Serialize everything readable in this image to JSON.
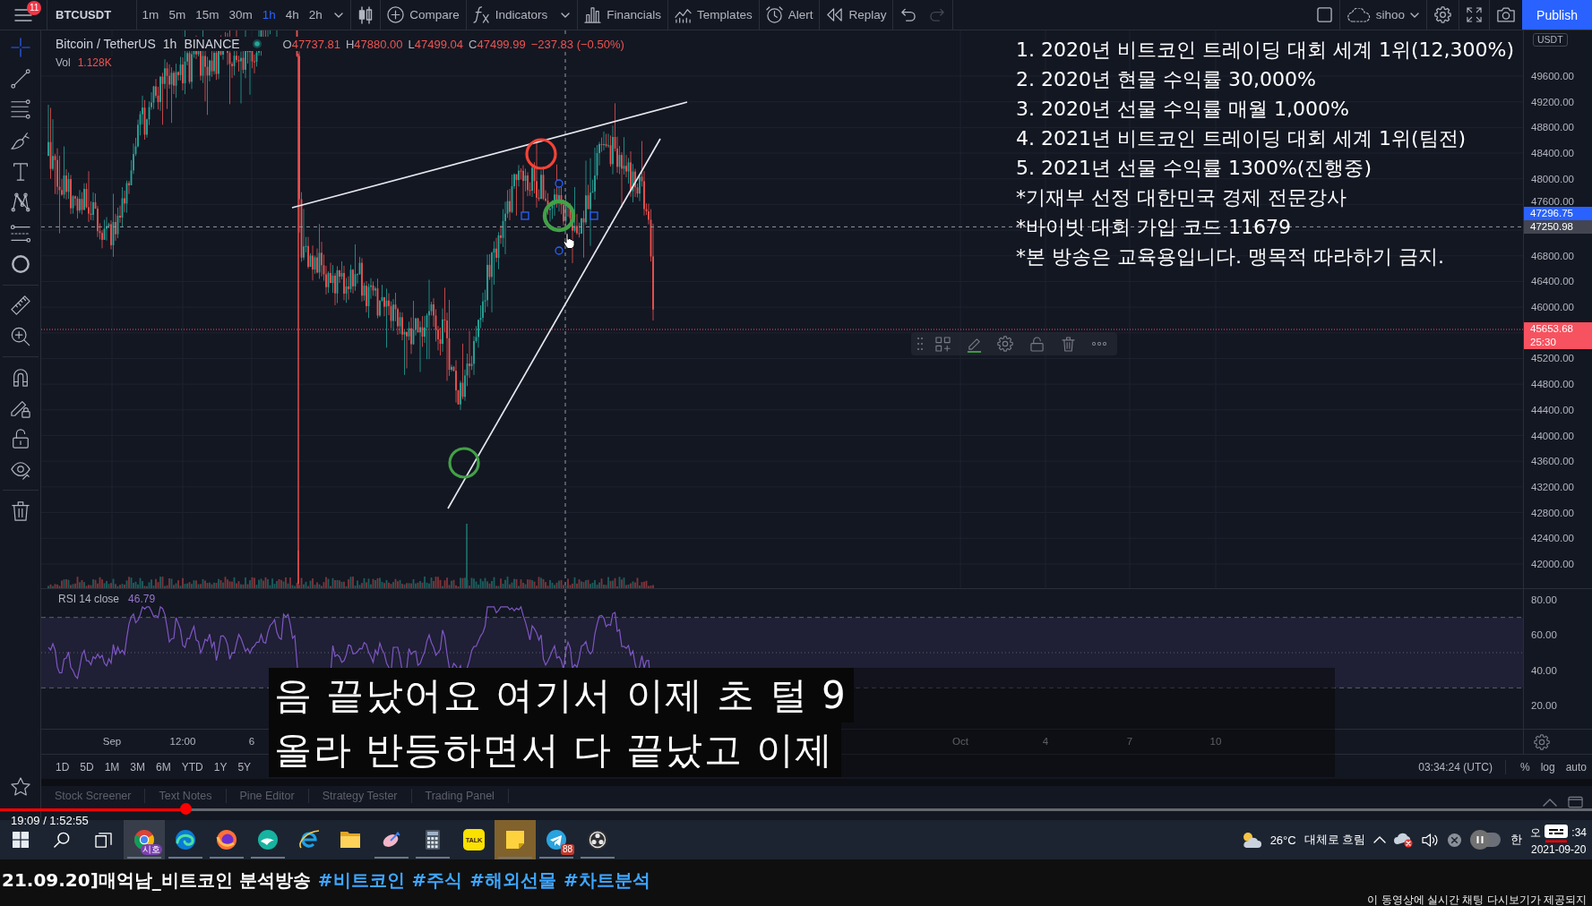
{
  "top_bar": {
    "menu_badge": "11",
    "symbol": "BTCUSDT",
    "intervals": [
      {
        "label": "1m",
        "selected": false
      },
      {
        "label": "5m",
        "selected": false
      },
      {
        "label": "15m",
        "selected": false
      },
      {
        "label": "30m",
        "selected": false
      },
      {
        "label": "1h",
        "selected": true
      },
      {
        "label": "4h",
        "selected": false
      },
      {
        "label": "2h",
        "selected": false
      }
    ],
    "tools": [
      {
        "kind": "compare",
        "label": "Compare"
      },
      {
        "kind": "indicators",
        "label": "Indicators"
      },
      {
        "kind": "financials",
        "label": "Financials"
      },
      {
        "kind": "templates",
        "label": "Templates"
      },
      {
        "kind": "alert",
        "label": "Alert"
      },
      {
        "kind": "replay",
        "label": "Replay"
      }
    ],
    "history": [
      {
        "kind": "undo",
        "disabled": false
      },
      {
        "kind": "redo",
        "disabled": true
      }
    ],
    "account": "sihoo",
    "publish": "Publish"
  },
  "drawing_tools": [
    {
      "kind": "crosshair",
      "selected": true
    },
    {
      "kind": "trend_line",
      "selected": false
    },
    {
      "kind": "fib",
      "selected": false
    },
    {
      "kind": "brush",
      "selected": false
    },
    {
      "kind": "text",
      "selected": false
    },
    {
      "kind": "pattern",
      "selected": false
    },
    {
      "kind": "prediction",
      "selected": false
    },
    {
      "kind": "circle",
      "selected": false
    },
    {
      "kind": "ruler",
      "selected": false
    },
    {
      "kind": "zoom",
      "selected": false
    },
    {
      "kind": "magnet",
      "selected": false
    },
    {
      "kind": "pencil_lock",
      "selected": false
    },
    {
      "kind": "lock",
      "selected": false
    },
    {
      "kind": "eye",
      "selected": false
    },
    {
      "kind": "trash",
      "selected": false
    },
    {
      "kind": "favorites",
      "selected": false
    }
  ],
  "legend": {
    "symbol": "Bitcoin / TetherUS",
    "interval": "1h",
    "exchange": "BINANCE",
    "ohlc": [
      {
        "label": "O",
        "value": "47737.81"
      },
      {
        "label": "H",
        "value": "47880.00"
      },
      {
        "label": "L",
        "value": "47499.04"
      },
      {
        "label": "C",
        "value": "47499.99"
      }
    ],
    "change": "−237.83 (−0.50%)",
    "volume": {
      "label": "Vol",
      "value": "1.128K"
    }
  },
  "info_overlay": [
    "1. 2020년 비트코인 트레이딩 대회 세계 1위(12,300%)",
    "2. 2020년 현물 수익률 30,000%",
    "3. 2020년 선물 수익률 매월 1,000%",
    "4. 2021년 비트코인 트레이딩 대회 세계 1위(팀전)",
    "5. 2021년 선물 수익률 1300%(진행중)",
    "*기재부 선정 대한민국 경제 전문강사",
    "*바이빗 대회 가입 코드 11679",
    "*본 방송은 교육용입니다. 맹목적 따라하기 금지."
  ],
  "drawings": [
    {
      "kind": "trend_line",
      "selected": false
    },
    {
      "kind": "trend_line",
      "selected": false
    },
    {
      "kind": "circle",
      "color": "#f44336",
      "selected": false
    },
    {
      "kind": "circle",
      "color": "#43a047",
      "selected": true
    },
    {
      "kind": "circle",
      "color": "#43a047",
      "selected": false
    }
  ],
  "price_axis": {
    "unit": "USDT",
    "labels": [
      "49600.00",
      "49200.00",
      "48800.00",
      "48400.00",
      "48000.00",
      "47600.00",
      "46800.00",
      "46400.00",
      "46000.00",
      "45200.00",
      "44800.00",
      "44400.00",
      "44000.00",
      "43600.00",
      "43200.00",
      "42800.00",
      "42400.00",
      "42000.00"
    ],
    "tags": [
      {
        "kind": "drawing",
        "value": "47296.75"
      },
      {
        "kind": "crosshair",
        "value": "47250.98"
      },
      {
        "kind": "last",
        "value": "45653.68",
        "countdown": "25:30"
      }
    ]
  },
  "rsi": {
    "label": "RSI 14 close",
    "value": "46.79",
    "axis_labels": [
      "80.00",
      "60.00",
      "40.00",
      "20.00"
    ]
  },
  "time_axis": [
    "Sep",
    "12:00",
    "6",
    "Oct",
    "4",
    "7",
    "10"
  ],
  "range_bar": {
    "ranges": [
      "1D",
      "5D",
      "1M",
      "3M",
      "6M",
      "YTD",
      "1Y",
      "5Y"
    ],
    "clock": "03:34:24 (UTC)",
    "scale_options": [
      "%",
      "log",
      "auto"
    ]
  },
  "bottom_tabs": [
    "Stock Screener",
    "Text Notes",
    "Pine Editor",
    "Strategy Tester",
    "Trading Panel"
  ],
  "captions": [
    "음 끝났어요 여기서 이제 초 털 9",
    "올라 반등하면서 다 끝났고 이제"
  ],
  "player": {
    "level": 0.117,
    "time": "19:09 / 1:52:55",
    "autoplay": {
      "on": false
    },
    "captions_button": {
      "on": true
    }
  },
  "taskbar": {
    "apps": [
      {
        "kind": "ring_browser",
        "badge": "시호",
        "focused": true,
        "flashing": false,
        "running": true
      },
      {
        "kind": "wave_browser",
        "focused": false,
        "flashing": false,
        "running": true
      },
      {
        "kind": "fox_browser",
        "focused": false,
        "flashing": false,
        "running": true
      },
      {
        "kind": "whale_browser",
        "focused": false,
        "flashing": false,
        "running": true
      },
      {
        "kind": "e_browser",
        "focused": false,
        "flashing": false,
        "running": false
      },
      {
        "kind": "folder",
        "focused": false,
        "flashing": false,
        "running": false
      },
      {
        "kind": "dish",
        "focused": false,
        "flashing": false,
        "running": true
      },
      {
        "kind": "calculator",
        "focused": false,
        "flashing": false,
        "running": true
      },
      {
        "kind": "chat",
        "label": "TALK",
        "focused": false,
        "flashing": false,
        "running": false
      },
      {
        "kind": "sticky_note",
        "focused": false,
        "flashing": true,
        "running": true
      },
      {
        "kind": "plane",
        "badge": "88",
        "focused": false,
        "flashing": false,
        "running": true
      },
      {
        "kind": "aperture",
        "focused": false,
        "flashing": false,
        "running": true
      }
    ],
    "weather": {
      "temperature": "26°C",
      "condition": "대체로 흐림"
    },
    "ime": "한",
    "clock": {
      "time_parts": [
        "오",
        ":34"
      ],
      "date": "2021-09-20"
    }
  },
  "video_title": {
    "text": "21.09.20]매억남_비트코인 분석방송",
    "hashtags": [
      "#비트코인",
      "#주식",
      "#해외선물",
      "#차트분석"
    ]
  },
  "chat_notice": "이 동영상에 실시간 채팅 다시보기가 제공되지"
}
